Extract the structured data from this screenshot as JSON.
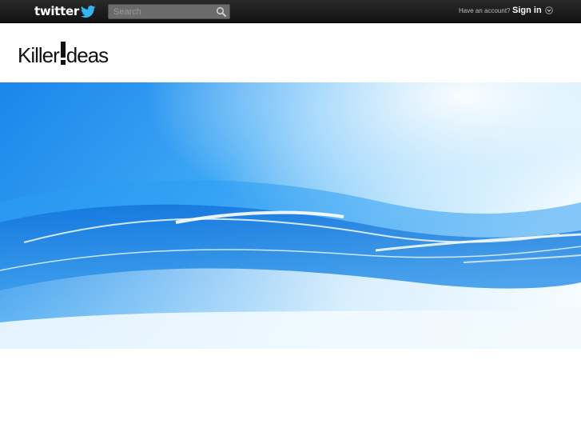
{
  "topbar": {
    "brand": "twitter",
    "search": {
      "placeholder": "Search",
      "value": ""
    },
    "account_prompt": "Have an account?",
    "signin_label": "Sign in"
  },
  "header": {
    "logo_left": "Killer",
    "logo_right": "deas"
  },
  "icons": {
    "brand": "bird-icon",
    "search": "search-icon",
    "signin": "chevron-down-icon"
  },
  "colors": {
    "topbar": "#1a1a1a",
    "hero_light": "#e6f5ff",
    "hero_blue": "#1f8ff0"
  }
}
